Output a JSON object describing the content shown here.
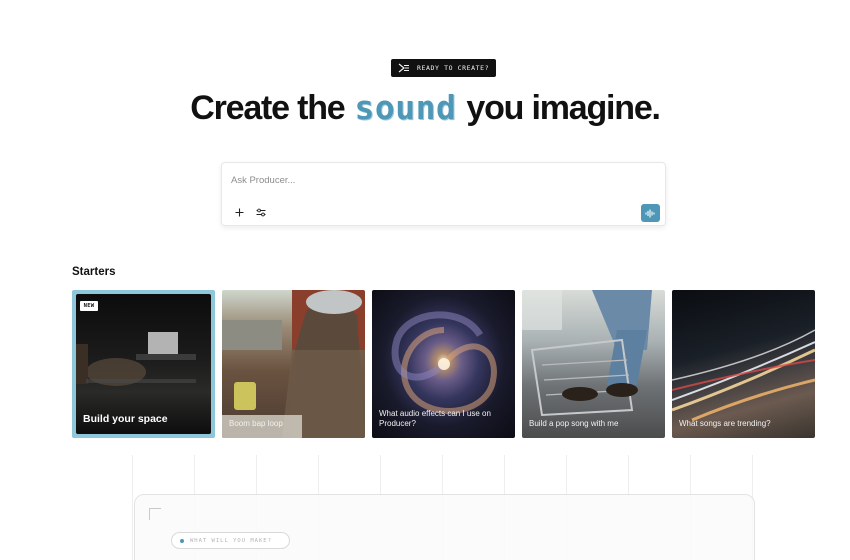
{
  "badge": {
    "icon": "terminal-arrow-icon",
    "text": "READY TO CREATE?"
  },
  "hero": {
    "before": "Create the",
    "highlight": "sound",
    "after": "you imagine.",
    "accent": "#4e97b6"
  },
  "prompt": {
    "placeholder": "Ask Producer...",
    "value": "",
    "add_icon": "plus-icon",
    "settings_icon": "sliders-icon",
    "voice_icon": "waveform-icon",
    "voice_color": "#4e97b6"
  },
  "starters": {
    "title": "Starters",
    "cards": [
      {
        "badge": "NEW",
        "label": "Build your space"
      },
      {
        "label": "Boom bap loop"
      },
      {
        "label": "What audio effects can I use on Producer?"
      },
      {
        "label": "Build a pop song with me"
      },
      {
        "label": "What songs are trending?"
      }
    ]
  },
  "bottom": {
    "pill_text": "WHAT WILL YOU MAKE?"
  }
}
